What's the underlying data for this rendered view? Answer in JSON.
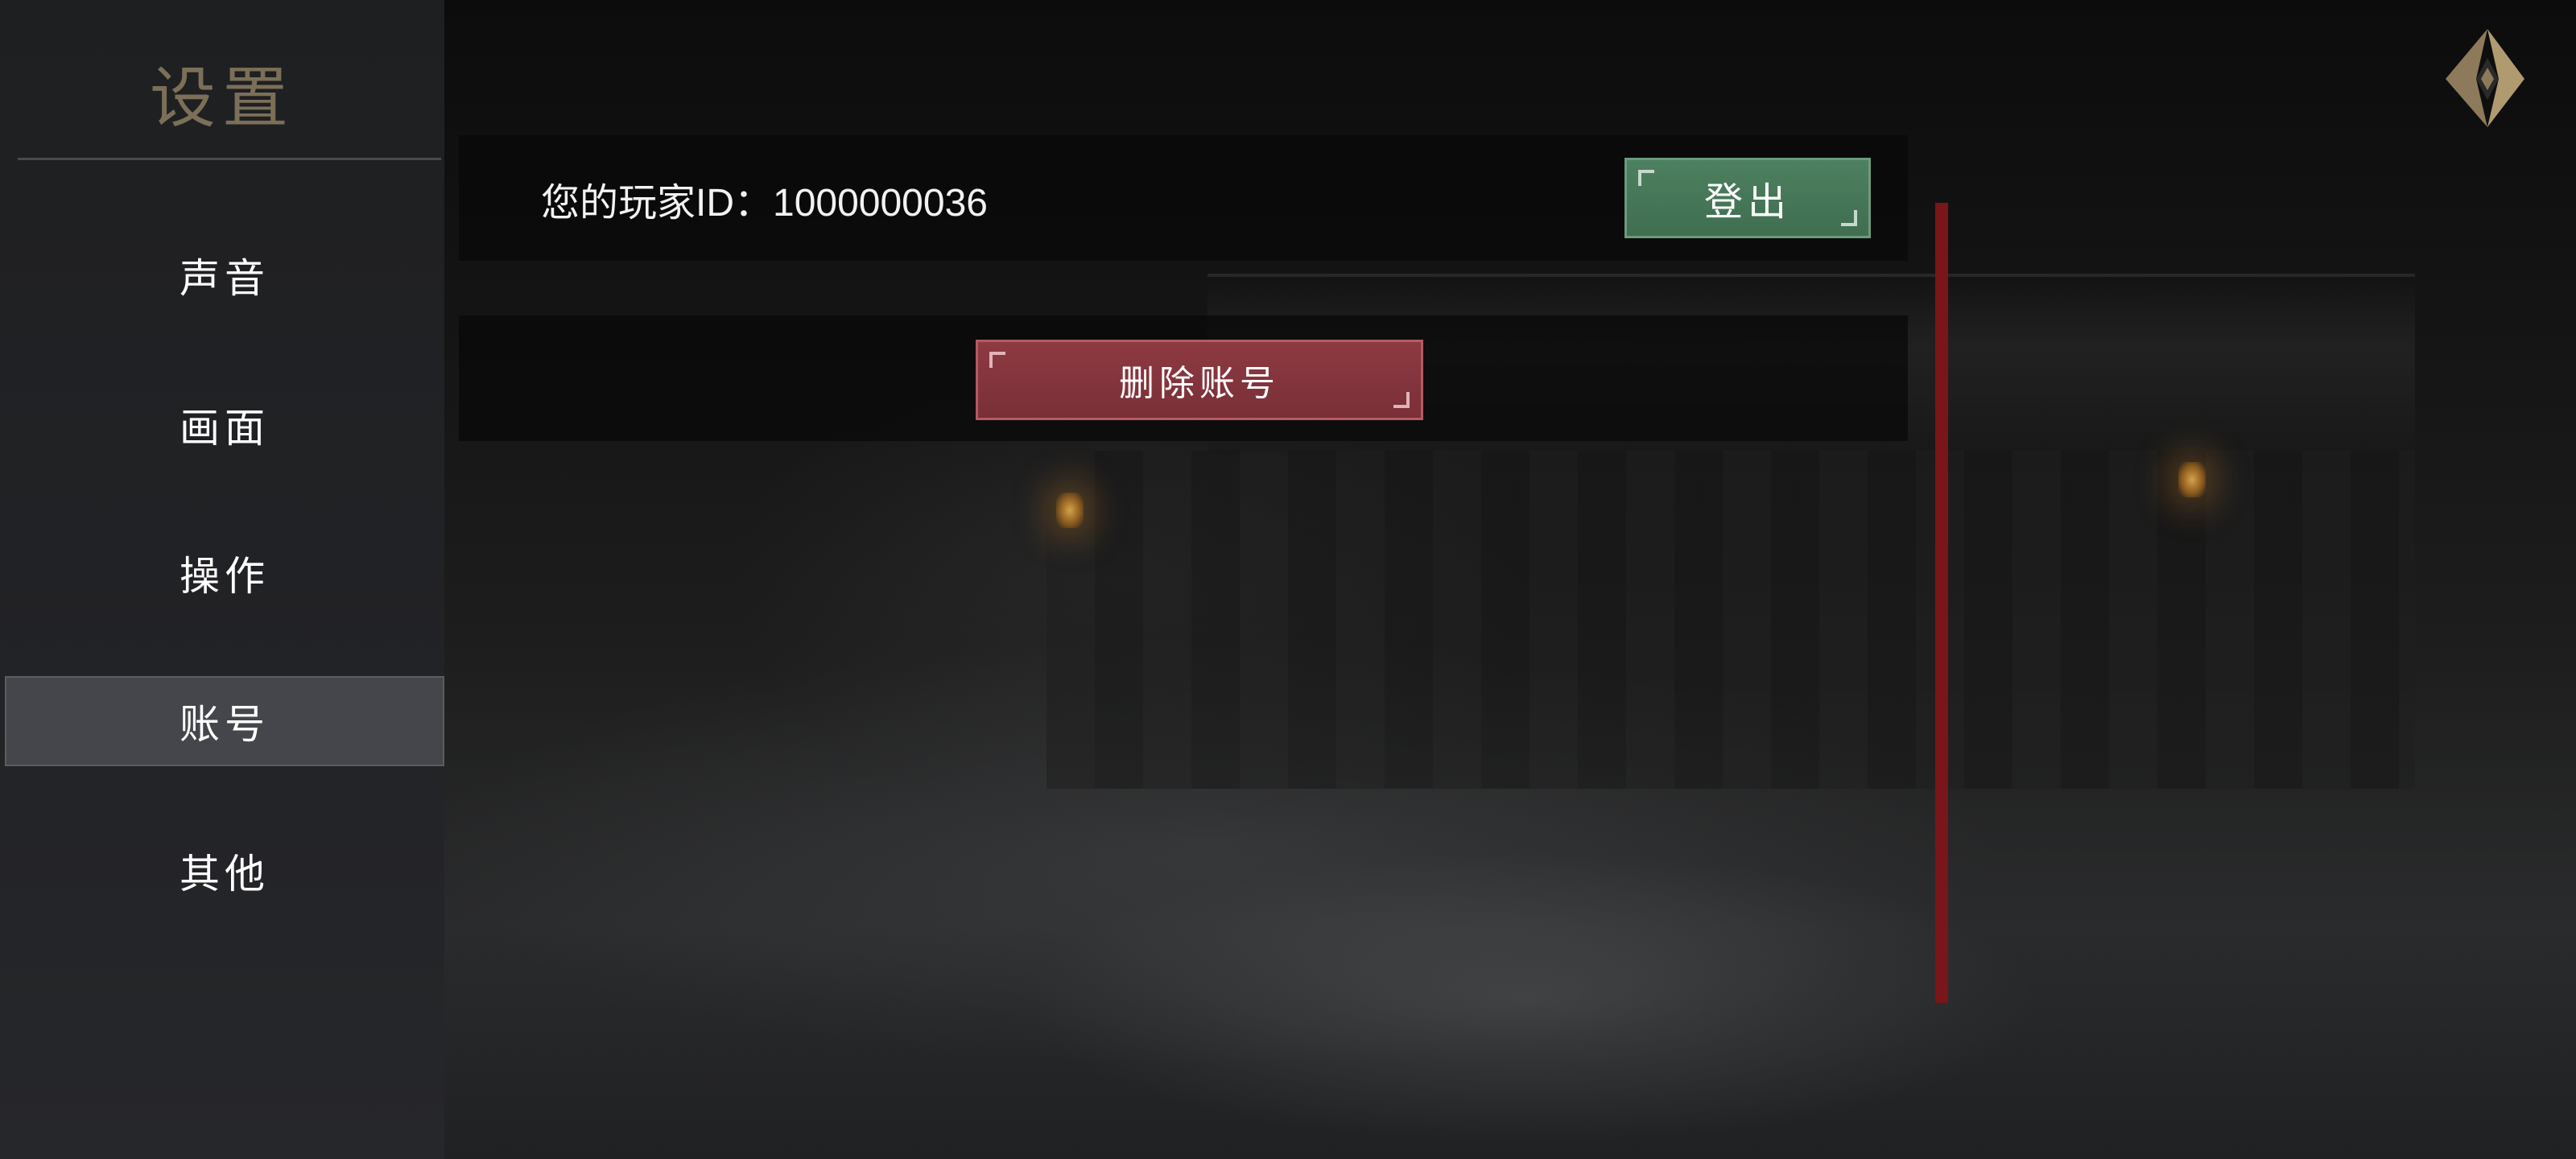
{
  "sidebar": {
    "title": "设置",
    "items": [
      {
        "label": "声音",
        "active": false
      },
      {
        "label": "画面",
        "active": false
      },
      {
        "label": "操作",
        "active": false
      },
      {
        "label": "账号",
        "active": true
      },
      {
        "label": "其他",
        "active": false
      }
    ]
  },
  "account": {
    "player_id_text": "您的玩家ID：1000000036",
    "logout_label": "登出",
    "delete_label": "删除账号"
  },
  "icons": {
    "back": "back-arrow-icon"
  },
  "colors": {
    "logout_button": "#4d8060",
    "delete_button": "#8d3a42",
    "active_tab": "#44464b",
    "title_gold": "#7b6f58",
    "scrollbar": "#7a1519"
  }
}
